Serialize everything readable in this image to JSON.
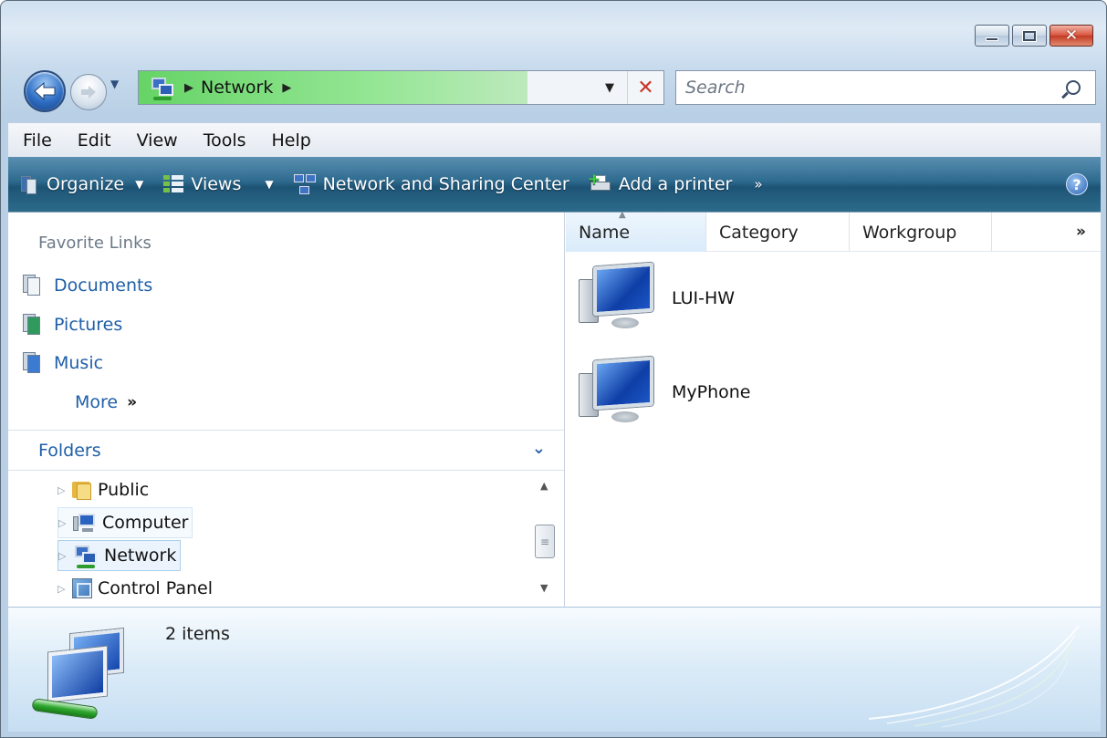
{
  "window": {
    "caption_buttons": [
      "minimize",
      "maximize",
      "close"
    ]
  },
  "navigation": {
    "back_icon": "back-arrow-icon",
    "forward_icon": "forward-arrow-icon"
  },
  "address": {
    "location_icon": "network-icon",
    "crumb": "Network",
    "progress_fraction": 0.74,
    "progress_color": "#66d466"
  },
  "search": {
    "placeholder": "Search"
  },
  "menu": {
    "items": [
      "File",
      "Edit",
      "View",
      "Tools",
      "Help"
    ]
  },
  "command_bar": {
    "organize": "Organize",
    "views": "Views",
    "network_sharing": "Network and Sharing Center",
    "add_printer": "Add a printer",
    "more": "»",
    "help": "?"
  },
  "favorites": {
    "title": "Favorite Links",
    "items": [
      {
        "label": "Documents",
        "icon": "documents-icon"
      },
      {
        "label": "Pictures",
        "icon": "pictures-icon"
      },
      {
        "label": "Music",
        "icon": "music-icon"
      }
    ],
    "more": "More",
    "more_arrows": "»"
  },
  "folders": {
    "title": "Folders",
    "tree": [
      {
        "label": "Public",
        "icon": "folder-icon"
      },
      {
        "label": "Computer",
        "icon": "computer-icon"
      },
      {
        "label": "Network",
        "icon": "network-icon",
        "selected": true
      },
      {
        "label": "Control Panel",
        "icon": "control-panel-icon"
      }
    ]
  },
  "file_list": {
    "columns": [
      "Name",
      "Category",
      "Workgroup"
    ],
    "more_columns": "»",
    "items": [
      {
        "label": "LUI-HW",
        "icon": "computer-icon"
      },
      {
        "label": "MyPhone",
        "icon": "computer-icon"
      }
    ]
  },
  "details": {
    "count": "2 items"
  },
  "colors": {
    "command_bar": "#2d6a8e",
    "link": "#1f5fa8",
    "close_button": "#c33a23"
  }
}
